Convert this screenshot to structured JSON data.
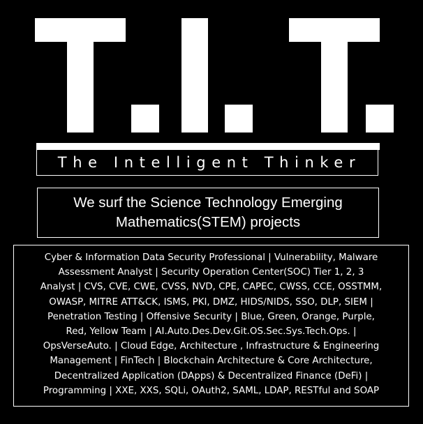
{
  "logo": {
    "text": "T. I. T."
  },
  "subtitle": "The Intelligent Thinker",
  "tagline": {
    "line1": "We surf the Science Technology Emerging",
    "line2": "Mathematics(STEM) projects"
  },
  "skills": {
    "lines": [
      "Cyber & Information Data Security Professional | Vulnerability, Malware",
      "Assessment Analyst | Security Operation Center(SOC) Tier 1, 2, 3",
      "Analyst | CVS, CVE, CWE, CVSS, NVD, CPE, CAPEC, CWSS, CCE, OSSTMM,",
      "OWASP, MITRE ATT&CK, ISMS, PKI, DMZ, HIDS/NIDS, SSO, DLP, SIEM |",
      "Penetration Testing | Offensive Security | Blue, Green, Orange, Purple,",
      "Red, Yellow Team | AI.Auto.Des.Dev.Git.OS.Sec.Sys.Tech.Ops. |",
      "OpsVerseAuto. | Cloud Edge, Architecture , Infrastructure & Engineering",
      "Management | FinTech | Blockchain Architecture & Core Architecture,",
      "Decentralized Application (DApps) & Decentralized Finance (DeFi) |",
      "Programming | XXE, XXS, SQLi, OAuth2, SAML, LDAP, RESTful and SOAP"
    ]
  },
  "colors": {
    "background": "#000000",
    "foreground": "#ffffff"
  }
}
